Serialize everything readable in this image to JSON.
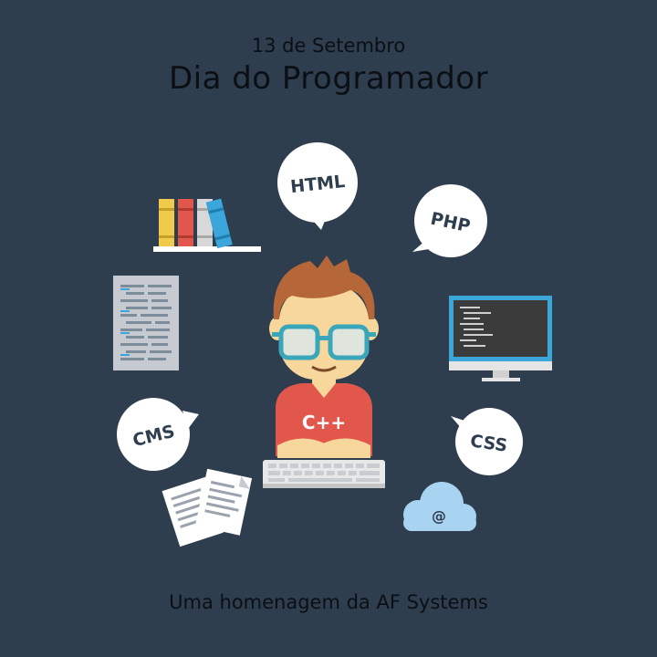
{
  "header": {
    "date": "13 de Setembro",
    "title": "Dia do Programador"
  },
  "footer": {
    "text": "Uma homenagem da AF Systems"
  },
  "bubbles": {
    "html": "HTML",
    "php": "PHP",
    "cms": "CMS",
    "css": "CSS"
  },
  "shirt_logo": "C++",
  "cloud_symbol": "@",
  "colors": {
    "background": "#2e3e4f",
    "text": "#0b0f14",
    "bubble": "#ffffff",
    "shirt": "#e2574c",
    "hair": "#b5673a",
    "glasses": "#3aa6b9",
    "skin": "#f7d79b",
    "cloud": "#a8d4f2"
  }
}
